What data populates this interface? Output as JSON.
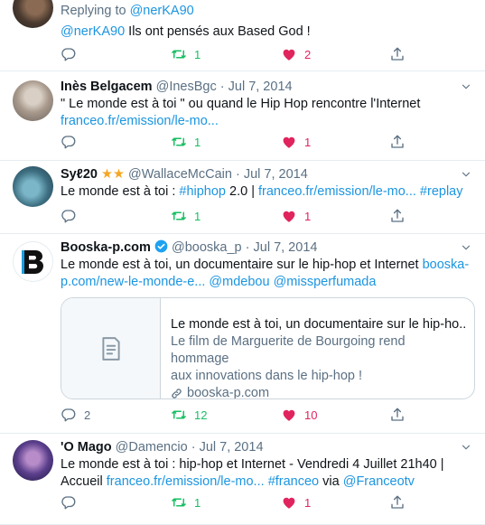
{
  "tweets": [
    {
      "reply_prefix": "Replying to ",
      "reply_handle": "@nerKA90",
      "text_handle": "@nerKA90",
      "text": " Ils ont pensés aux Based God !",
      "reply_count": "",
      "rt_count": "1",
      "like_count": "2"
    },
    {
      "name": "Inès Belgacem",
      "handle": "@InesBgc",
      "date": "Jul 7, 2014",
      "text": "\" Le monde est à toi \" ou quand le Hip Hop rencontre l'Internet",
      "link": "franceo.fr/emission/le-mo...",
      "reply_count": "",
      "rt_count": "1",
      "like_count": "1"
    },
    {
      "name": "Syℓ20",
      "handle": "@WallaceMcCain",
      "date": "Jul 7, 2014",
      "text_pre": "Le monde est à toi : ",
      "hashtag1": "#hiphop",
      "text_mid": " 2.0 | ",
      "link": "franceo.fr/emission/le-mo...",
      "hashtag2": "#replay",
      "reply_count": "",
      "rt_count": "1",
      "like_count": "1"
    },
    {
      "name": "Booska-p.com",
      "handle": "@booska_p",
      "date": "Jul 7, 2014",
      "text": "Le monde est à toi, un documentaire sur le hip-hop et Internet ",
      "link_part1": "booska-",
      "link_part2": "p.com/new-le-monde-e...",
      "mention1": "@mdebou",
      "mention2": "@missperfumada",
      "card": {
        "title": "Le monde est à toi, un documentaire sur le hip-ho...",
        "desc_line1": "Le film de Marguerite de Bourgoing rend hommage",
        "desc_line2": "aux innovations dans le hip-hop !",
        "domain": "booska-p.com"
      },
      "reply_count": "2",
      "rt_count": "12",
      "like_count": "10"
    },
    {
      "name": "'O Mago",
      "handle": "@Damencio",
      "date": "Jul 7, 2014",
      "text_line1": "Le monde est à toi : hip-hop et Internet - Vendredi 4 Juillet 21h40 |",
      "text_pre": "Accueil ",
      "link": "franceo.fr/emission/le-mo...",
      "hashtag": "#franceo",
      "text_via": " via ",
      "mention": "@Franceotv",
      "reply_count": "",
      "rt_count": "1",
      "like_count": "1"
    }
  ],
  "colors": {
    "link": "#1b95e0",
    "retweet": "#17bf63",
    "like": "#e0245e",
    "verified": "#1da1f2",
    "star": "#f5a623"
  }
}
